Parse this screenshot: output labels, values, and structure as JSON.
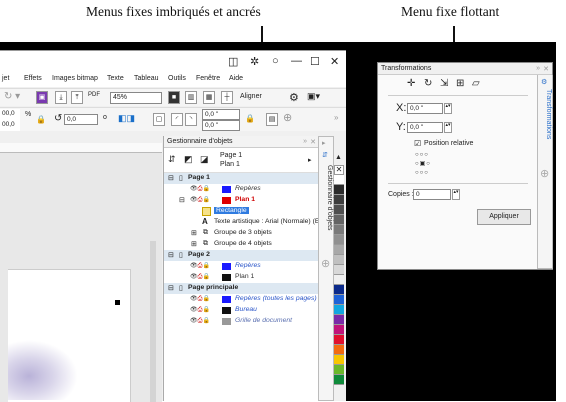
{
  "captions": {
    "left": "Menus fixes imbriqués et ancrés",
    "right": "Menu fixe flottant"
  },
  "window": {
    "controls": [
      "◫",
      "✲",
      "○",
      "—",
      "☐",
      "✕"
    ]
  },
  "menubar": [
    "jet",
    "Effets",
    "Images bitmap",
    "Texte",
    "Tableau",
    "Outils",
    "Fenêtre",
    "Aide"
  ],
  "toolbar1": {
    "zoom": "45%",
    "align": "Aligner",
    "pdf_label": "PDF"
  },
  "toolbar2": {
    "val1": "00,0",
    "val2": "00,0",
    "unit": "%",
    "rotation": "0,0",
    "degree": "o",
    "pos1": "0,0 \"",
    "pos2": "0,0 \""
  },
  "object_manager": {
    "title": "Gestionnaire d'objets",
    "tab_label": "Gestionnaire d'objets",
    "page_selector": [
      "Page 1",
      "Plan 1"
    ],
    "rows": [
      {
        "text": "Page 1",
        "kind": "page"
      },
      {
        "text": "Repères",
        "kind": "layer",
        "color": "#1a1aff",
        "italic": true,
        "textcolor": "#333"
      },
      {
        "text": "Plan 1",
        "kind": "layer",
        "color": "#e00000",
        "bold": true,
        "textcolor": "#d00000"
      },
      {
        "text": "Rectangle",
        "kind": "object",
        "selected": true
      },
      {
        "text": "Texte artistique : Arial (Normale) (Ei",
        "kind": "object"
      },
      {
        "text": "Groupe de 3 objets",
        "kind": "group"
      },
      {
        "text": "Groupe de 4 objets",
        "kind": "group"
      },
      {
        "text": "Page 2",
        "kind": "page"
      },
      {
        "text": "Repères",
        "kind": "layer",
        "color": "#1a1aff",
        "italic": true
      },
      {
        "text": "Plan 1",
        "kind": "layer",
        "color": "#111111"
      },
      {
        "text": "Page principale",
        "kind": "page"
      },
      {
        "text": "Repères (toutes les pages)",
        "kind": "layer",
        "color": "#1a1aff",
        "italic": true
      },
      {
        "text": "Bureau",
        "kind": "layer",
        "color": "#111111",
        "italic": true
      },
      {
        "text": "Grille de document",
        "kind": "layer",
        "color": "#999999",
        "italic": true
      }
    ]
  },
  "palette": [
    "#ffffff",
    "#2b2b2b",
    "#3d3d3d",
    "#4f4f4f",
    "#646464",
    "#7a7a7a",
    "#909090",
    "#a8a8a8",
    "#c0c0c0",
    "#d8d8d8",
    "#f0f0f0",
    "#0b2a8a",
    "#1e62d6",
    "#12a6e0",
    "#7a2aa8",
    "#c0147a",
    "#e0102e",
    "#f26b10",
    "#f7c600",
    "#6ab82a",
    "#0f8a3a"
  ],
  "transformations": {
    "title": "Transformations",
    "tab_label": "Transformations",
    "x_label": "X:",
    "x_value": "0,0 \"",
    "y_label": "Y:",
    "y_value": "0,0 \"",
    "relative_label": "Position relative",
    "copies_label": "Copies :",
    "copies_value": "0",
    "apply": "Appliquer"
  }
}
